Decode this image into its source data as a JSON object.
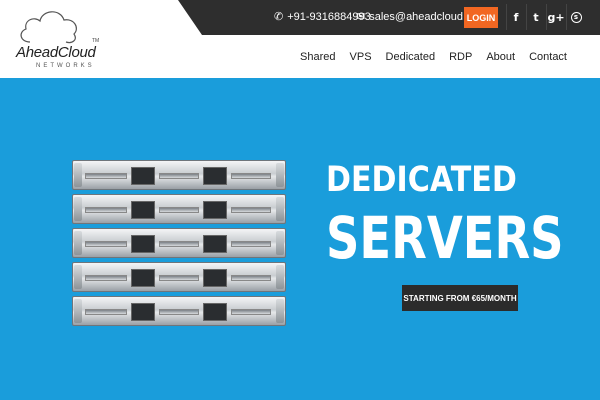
{
  "brand": {
    "name": "AheadCloud",
    "tm": "TM",
    "subtitle": "NETWORKS"
  },
  "topbar": {
    "phone": "+91-9316884993",
    "email": "sales@aheadcloud.com",
    "login_label": "LOGIN",
    "social": [
      {
        "icon": "facebook-icon",
        "glyph": "f"
      },
      {
        "icon": "twitter-icon",
        "glyph": "t"
      },
      {
        "icon": "google-plus-icon",
        "glyph": "g+"
      },
      {
        "icon": "skype-icon",
        "glyph": "s"
      }
    ]
  },
  "nav": {
    "items": [
      "Shared",
      "VPS",
      "Dedicated",
      "RDP",
      "About",
      "Contact"
    ]
  },
  "hero": {
    "heading_line1": "DEDICATED",
    "heading_line2": "SERVERS",
    "badge": "STARTING FROM €65/MONTH"
  },
  "colors": {
    "hero_bg": "#1a9ddb",
    "topbar_bg": "#2e2e2e",
    "login_bg": "#f26722",
    "badge_bg": "#2b2b2b"
  }
}
